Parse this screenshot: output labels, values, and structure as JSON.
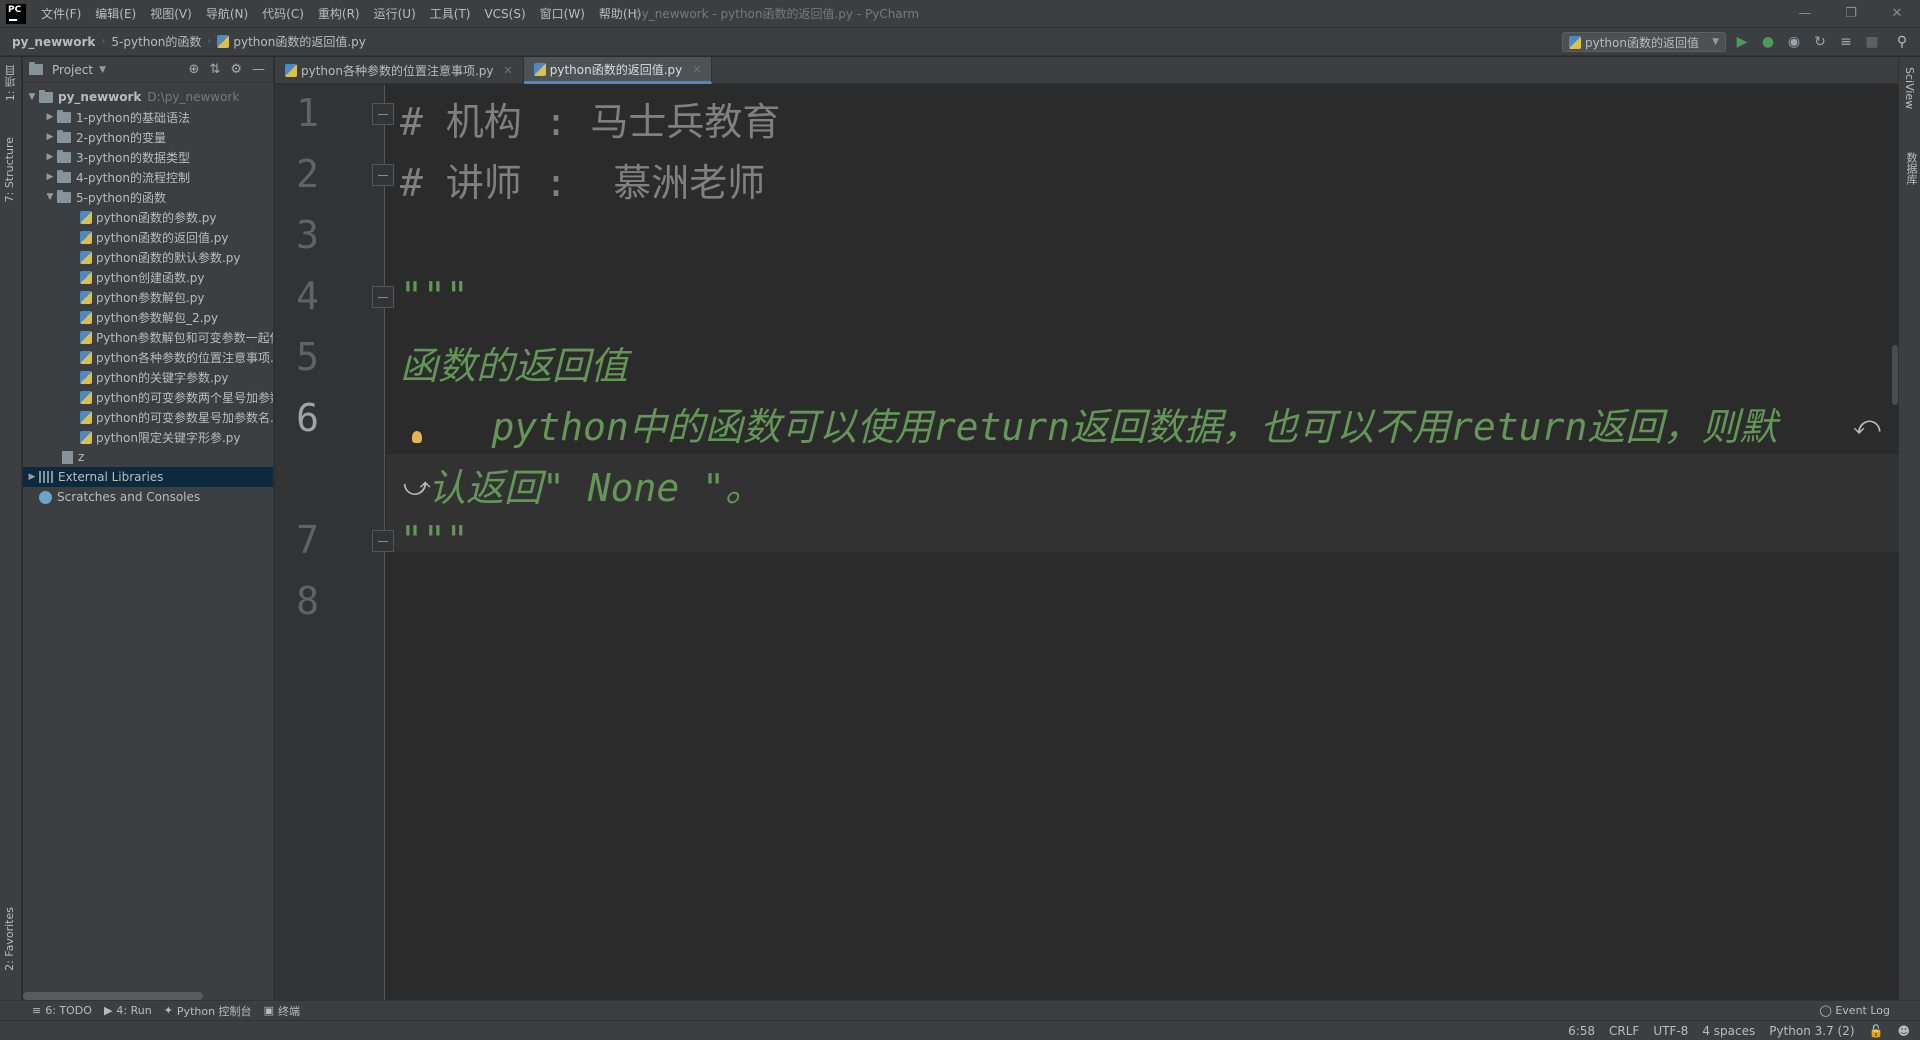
{
  "menu": [
    "文件(F)",
    "编辑(E)",
    "视图(V)",
    "导航(N)",
    "代码(C)",
    "重构(R)",
    "运行(U)",
    "工具(T)",
    "VCS(S)",
    "窗口(W)",
    "帮助(H)"
  ],
  "window_title": "py_newwork - python函数的返回值.py - PyCharm",
  "app_logo": "PC",
  "breadcrumb": {
    "project": "py_newwork",
    "folder": "5-python的函数",
    "file": "python函数的返回值.py"
  },
  "run_config": "python函数的返回值",
  "project_panel": {
    "title": "Project",
    "root": {
      "name": "py_newwork",
      "path": "D:\\py_newwork"
    },
    "folders": [
      "1-python的基础语法",
      "2-python的变量",
      "3-python的数据类型",
      "4-python的流程控制",
      "5-python的函数"
    ],
    "files": [
      "python函数的参数.py",
      "python函数的返回值.py",
      "python函数的默认参数.py",
      "python创建函数.py",
      "python参数解包.py",
      "python参数解包_2.py",
      "Python参数解包和可变参数一起使用",
      "python各种参数的位置注意事项.py",
      "python的关键字参数.py",
      "python的可变参数两个星号加参数名",
      "python的可变参数星号加参数名.py",
      "python限定关键字形参.py"
    ],
    "z_file": "z",
    "external_libraries": "External Libraries",
    "scratches": "Scratches and Consoles"
  },
  "tabs": [
    {
      "label": "python各种参数的位置注意事项.py"
    },
    {
      "label": "python函数的返回值.py"
    }
  ],
  "editor": {
    "line_numbers": [
      "1",
      "2",
      "3",
      "4",
      "5",
      "6",
      "7",
      "8"
    ],
    "line1": "# 机构 : 马士兵教育",
    "line2": "# 讲师 :  慕洲老师",
    "line4": "\"\"\"",
    "line5": "函数的返回值",
    "line6a": "    python中的函数可以使用return返回数据，也可以不用return返回，则默",
    "line6b": "认返回\" None \"。",
    "line7": "\"\"\""
  },
  "left_strip": {
    "project_tab": "1: 项目",
    "structure_tab": "7: Structure",
    "favorites_tab": "2: Favorites"
  },
  "right_strip": {
    "sciview_tab": "SciView",
    "database_tab": "数据库"
  },
  "bottom_tools": {
    "todo": "6: TODO",
    "run": "4: Run",
    "console": "Python 控制台",
    "terminal": "终端",
    "event_log": "Event Log"
  },
  "status": {
    "position": "6:58",
    "line_sep": "CRLF",
    "encoding": "UTF-8",
    "indent": "4 spaces",
    "interpreter": "Python 3.7 (2)"
  },
  "colors": {
    "accent": "#4a88c7",
    "docstring": "#629755",
    "comment": "#808080",
    "selection": "#0d293e"
  }
}
